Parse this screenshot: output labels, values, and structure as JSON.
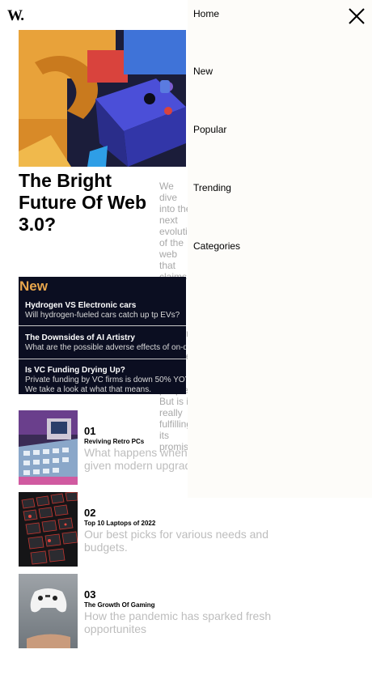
{
  "logo": "W.",
  "hero": {
    "title": "The Bright Future Of Web 3.0?",
    "description": "We dive into the next evolution of the web that claims to put the power of the platforms back into the hands of the people. But is it really fulfilling its promise?"
  },
  "new_section": {
    "heading": "New",
    "items": [
      {
        "title": "Hydrogen VS Electronic cars",
        "desc": "Will hydrogen-fueled cars catch up tp EVs?"
      },
      {
        "title": "The Downsides of AI Artistry",
        "desc": "What are the possible adverse effects of on-demand AI image generation?"
      },
      {
        "title": "Is VC Funding Drying Up?",
        "desc": "Private funding by VC firms is down 50% YOY. We take a look at what that means."
      }
    ]
  },
  "articles": [
    {
      "num": "01",
      "title": "Reviving Retro PCs",
      "desc": "What happens when old PCs are given modern upgrades?"
    },
    {
      "num": "02",
      "title": "Top 10 Laptops of 2022",
      "desc": "Our best picks for various needs and budgets."
    },
    {
      "num": "03",
      "title": "The Growth Of Gaming",
      "desc": "How the pandemic has sparked fresh opportunites"
    }
  ],
  "menu": {
    "items": [
      "Home",
      "New",
      "Popular",
      "Trending",
      "Categories"
    ]
  },
  "colors": {
    "accent": "#e8a64c",
    "new_bg": "#0b0e21",
    "menu_bg": "#fdfcf9",
    "muted_text": "#bdbdbd"
  },
  "icons": {
    "close": "close-icon"
  }
}
